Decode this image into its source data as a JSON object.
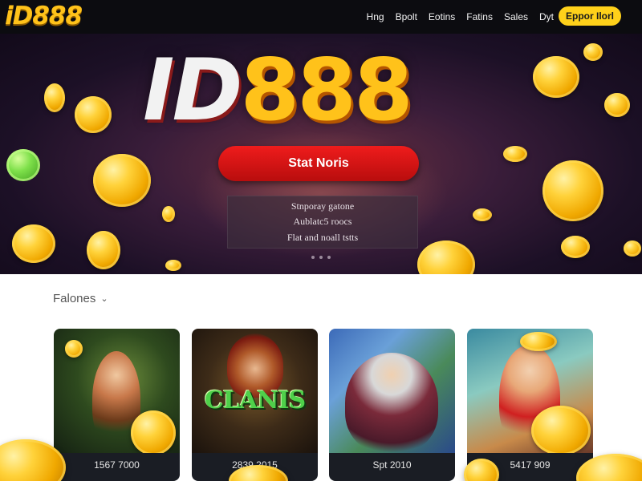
{
  "brand": {
    "logo": "iD888"
  },
  "nav": {
    "links": [
      "Hng",
      "Bpolt",
      "Eotins",
      "Fatins",
      "Sales",
      "Dyt"
    ],
    "cta": "Eppor Ilorl"
  },
  "hero": {
    "title_id": "ID",
    "title_num": "888",
    "button_label": "Stat Noris",
    "panel_lines": [
      "Stnporay gatone",
      "Aublatc5 roocs",
      "Flat and noall tstts"
    ]
  },
  "section": {
    "title": "Falones"
  },
  "games": [
    {
      "caption": "1567 7000"
    },
    {
      "caption": "2839 2015",
      "art_text": "CLANIS"
    },
    {
      "caption": "Spt 2010"
    },
    {
      "caption": "5417 909"
    }
  ],
  "colors": {
    "accent_gold": "#ffc21a",
    "cta_red": "#e01515",
    "nav_bg": "#0c0c10"
  }
}
